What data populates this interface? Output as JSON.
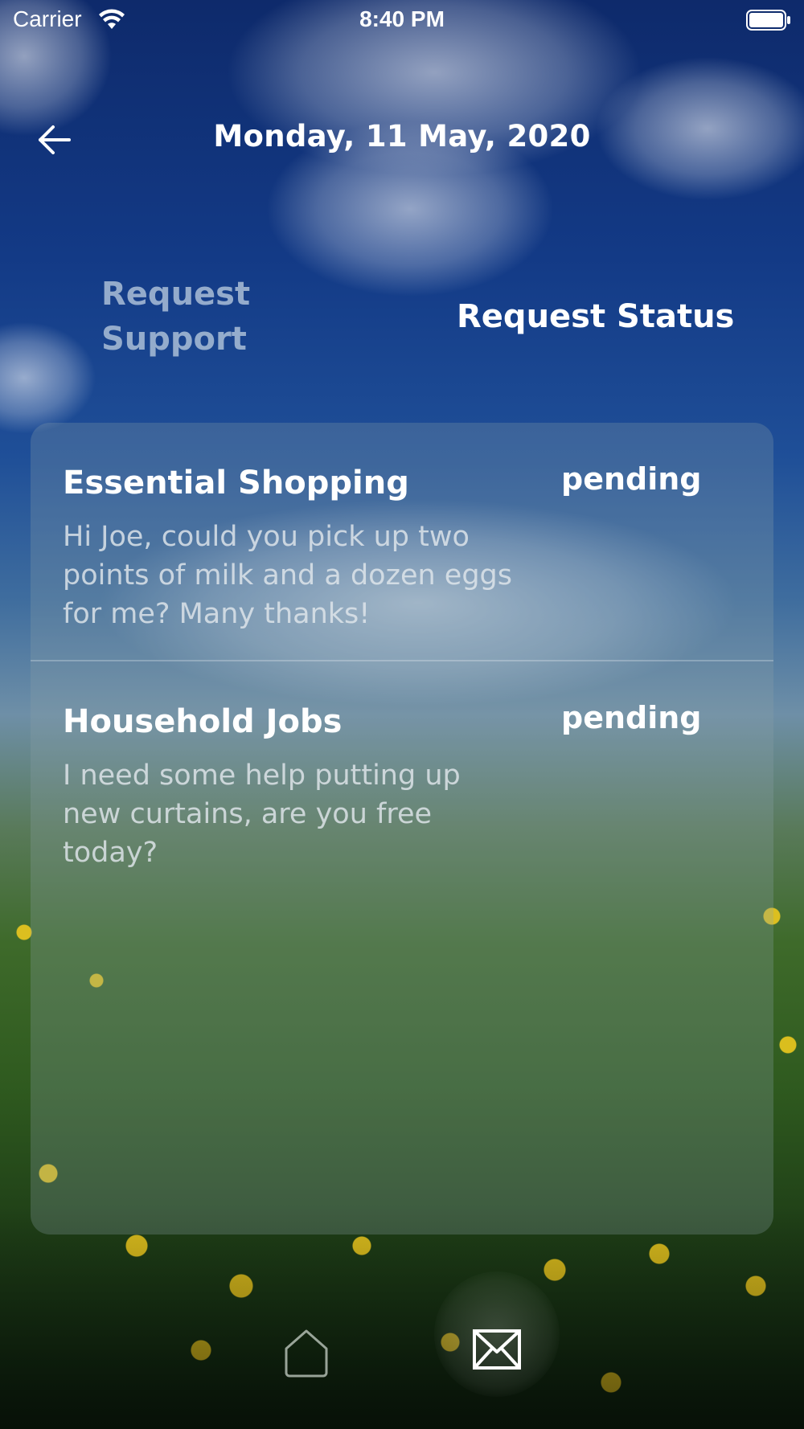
{
  "status_bar": {
    "carrier": "Carrier",
    "time": "8:40 PM"
  },
  "header": {
    "title": "Monday, 11 May, 2020",
    "back_icon": "arrow-left-icon"
  },
  "tabs": [
    {
      "label": "Request Support",
      "active": false
    },
    {
      "label": "Request Status",
      "active": true
    }
  ],
  "requests": [
    {
      "title": "Essential Shopping",
      "status": "pending",
      "body": "Hi Joe, could you pick up two points of milk and a dozen eggs for me? Many thanks!"
    },
    {
      "title": "Household Jobs",
      "status": "pending",
      "body": "I need some help putting up new curtains, are you free today?"
    }
  ],
  "bottom_nav": {
    "items": [
      {
        "icon": "home-icon",
        "active": false
      },
      {
        "icon": "envelope-icon",
        "active": true
      }
    ]
  },
  "colors": {
    "sky_top": "#0e2a6b",
    "grass": "#3e6a2a",
    "text_primary": "#ffffff",
    "tab_inactive": "#aabed7"
  }
}
